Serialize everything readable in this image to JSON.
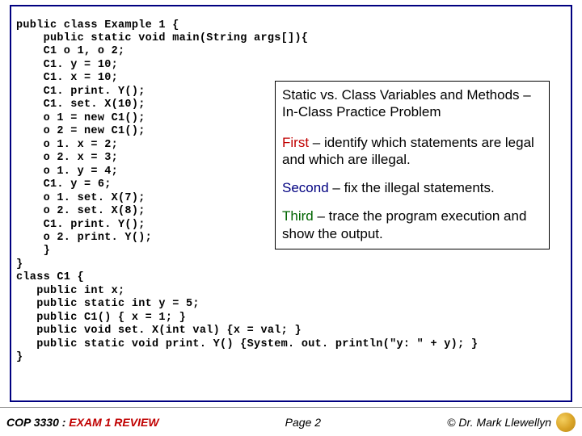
{
  "code": "public class Example 1 {\n    public static void main(String args[]){\n    C1 o 1, o 2;\n    C1. y = 10;\n    C1. x = 10;\n    C1. print. Y();\n    C1. set. X(10);\n    o 1 = new C1();\n    o 2 = new C1();\n    o 1. x = 2;\n    o 2. x = 3;\n    o 1. y = 4;\n    C1. y = 6;\n    o 1. set. X(7);\n    o 2. set. X(8);\n    C1. print. Y();\n    o 2. print. Y();\n    }\n}\nclass C1 {\n   public int x;\n   public static int y = 5;\n   public C1() { x = 1; }\n   public void set. X(int val) {x = val; }\n   public static void print. Y() {System. out. println(\"y: \" + y); }\n}",
  "info": {
    "title": "Static vs. Class Variables and Methods – In-Class Practice Problem",
    "first_label": "First",
    "first_rest": " – identify which statements are legal and which are illegal.",
    "second_label": "Second",
    "second_rest": " – fix the illegal statements.",
    "third_label": "Third",
    "third_rest": " – trace the program execution and show the output."
  },
  "footer": {
    "course": "COP 3330 : ",
    "review": "EXAM 1 REVIEW",
    "page": "Page 2",
    "copyright": "© Dr. Mark Llewellyn"
  }
}
